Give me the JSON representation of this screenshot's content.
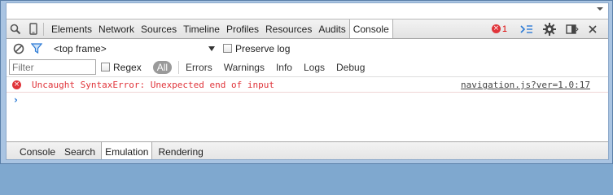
{
  "toolbar": {
    "tabs": [
      "Elements",
      "Network",
      "Sources",
      "Timeline",
      "Profiles",
      "Resources",
      "Audits",
      "Console"
    ],
    "error_count": "1"
  },
  "frame_row": {
    "frame_label": "<top frame>",
    "preserve_log_label": "Preserve log"
  },
  "filter_row": {
    "filter_placeholder": "Filter",
    "regex_label": "Regex",
    "levels": [
      "All",
      "Errors",
      "Warnings",
      "Info",
      "Logs",
      "Debug"
    ]
  },
  "console": {
    "message_text": "Uncaught SyntaxError: Unexpected end of input",
    "message_source": "navigation.js?ver=1.0:17",
    "prompt_symbol": "›"
  },
  "drawer": {
    "tabs": [
      "Console",
      "Search",
      "Emulation",
      "Rendering"
    ]
  },
  "colors": {
    "error_red": "#e0343a",
    "prompt_blue": "#2d7bd6",
    "window_frame": "#a9c4e2"
  }
}
